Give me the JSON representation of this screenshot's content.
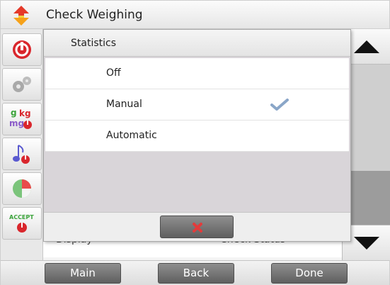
{
  "window": {
    "title": "Check Weighing"
  },
  "sidebar": {
    "items": [
      {
        "name": "power-icon"
      },
      {
        "name": "gears-icon"
      },
      {
        "name": "units-icon",
        "label_top": "g kg",
        "label_bottom": "mg"
      },
      {
        "name": "music-note-icon"
      },
      {
        "name": "pie-chart-icon"
      },
      {
        "name": "accept-icon",
        "label": "ACCEPT"
      }
    ]
  },
  "underlying_list": {
    "row_label": "Display",
    "row_value": "Check Status"
  },
  "dialog": {
    "title": "Statistics",
    "options": [
      {
        "label": "Off",
        "selected": false
      },
      {
        "label": "Manual",
        "selected": true
      },
      {
        "label": "Automatic",
        "selected": false
      }
    ],
    "cancel_icon": "x-icon"
  },
  "bottom_bar": {
    "main_label": "Main",
    "back_label": "Back",
    "done_label": "Done"
  },
  "colors": {
    "accent_red": "#d9262c",
    "check_blue": "#8aa6c8",
    "button_gray": "#707070"
  }
}
